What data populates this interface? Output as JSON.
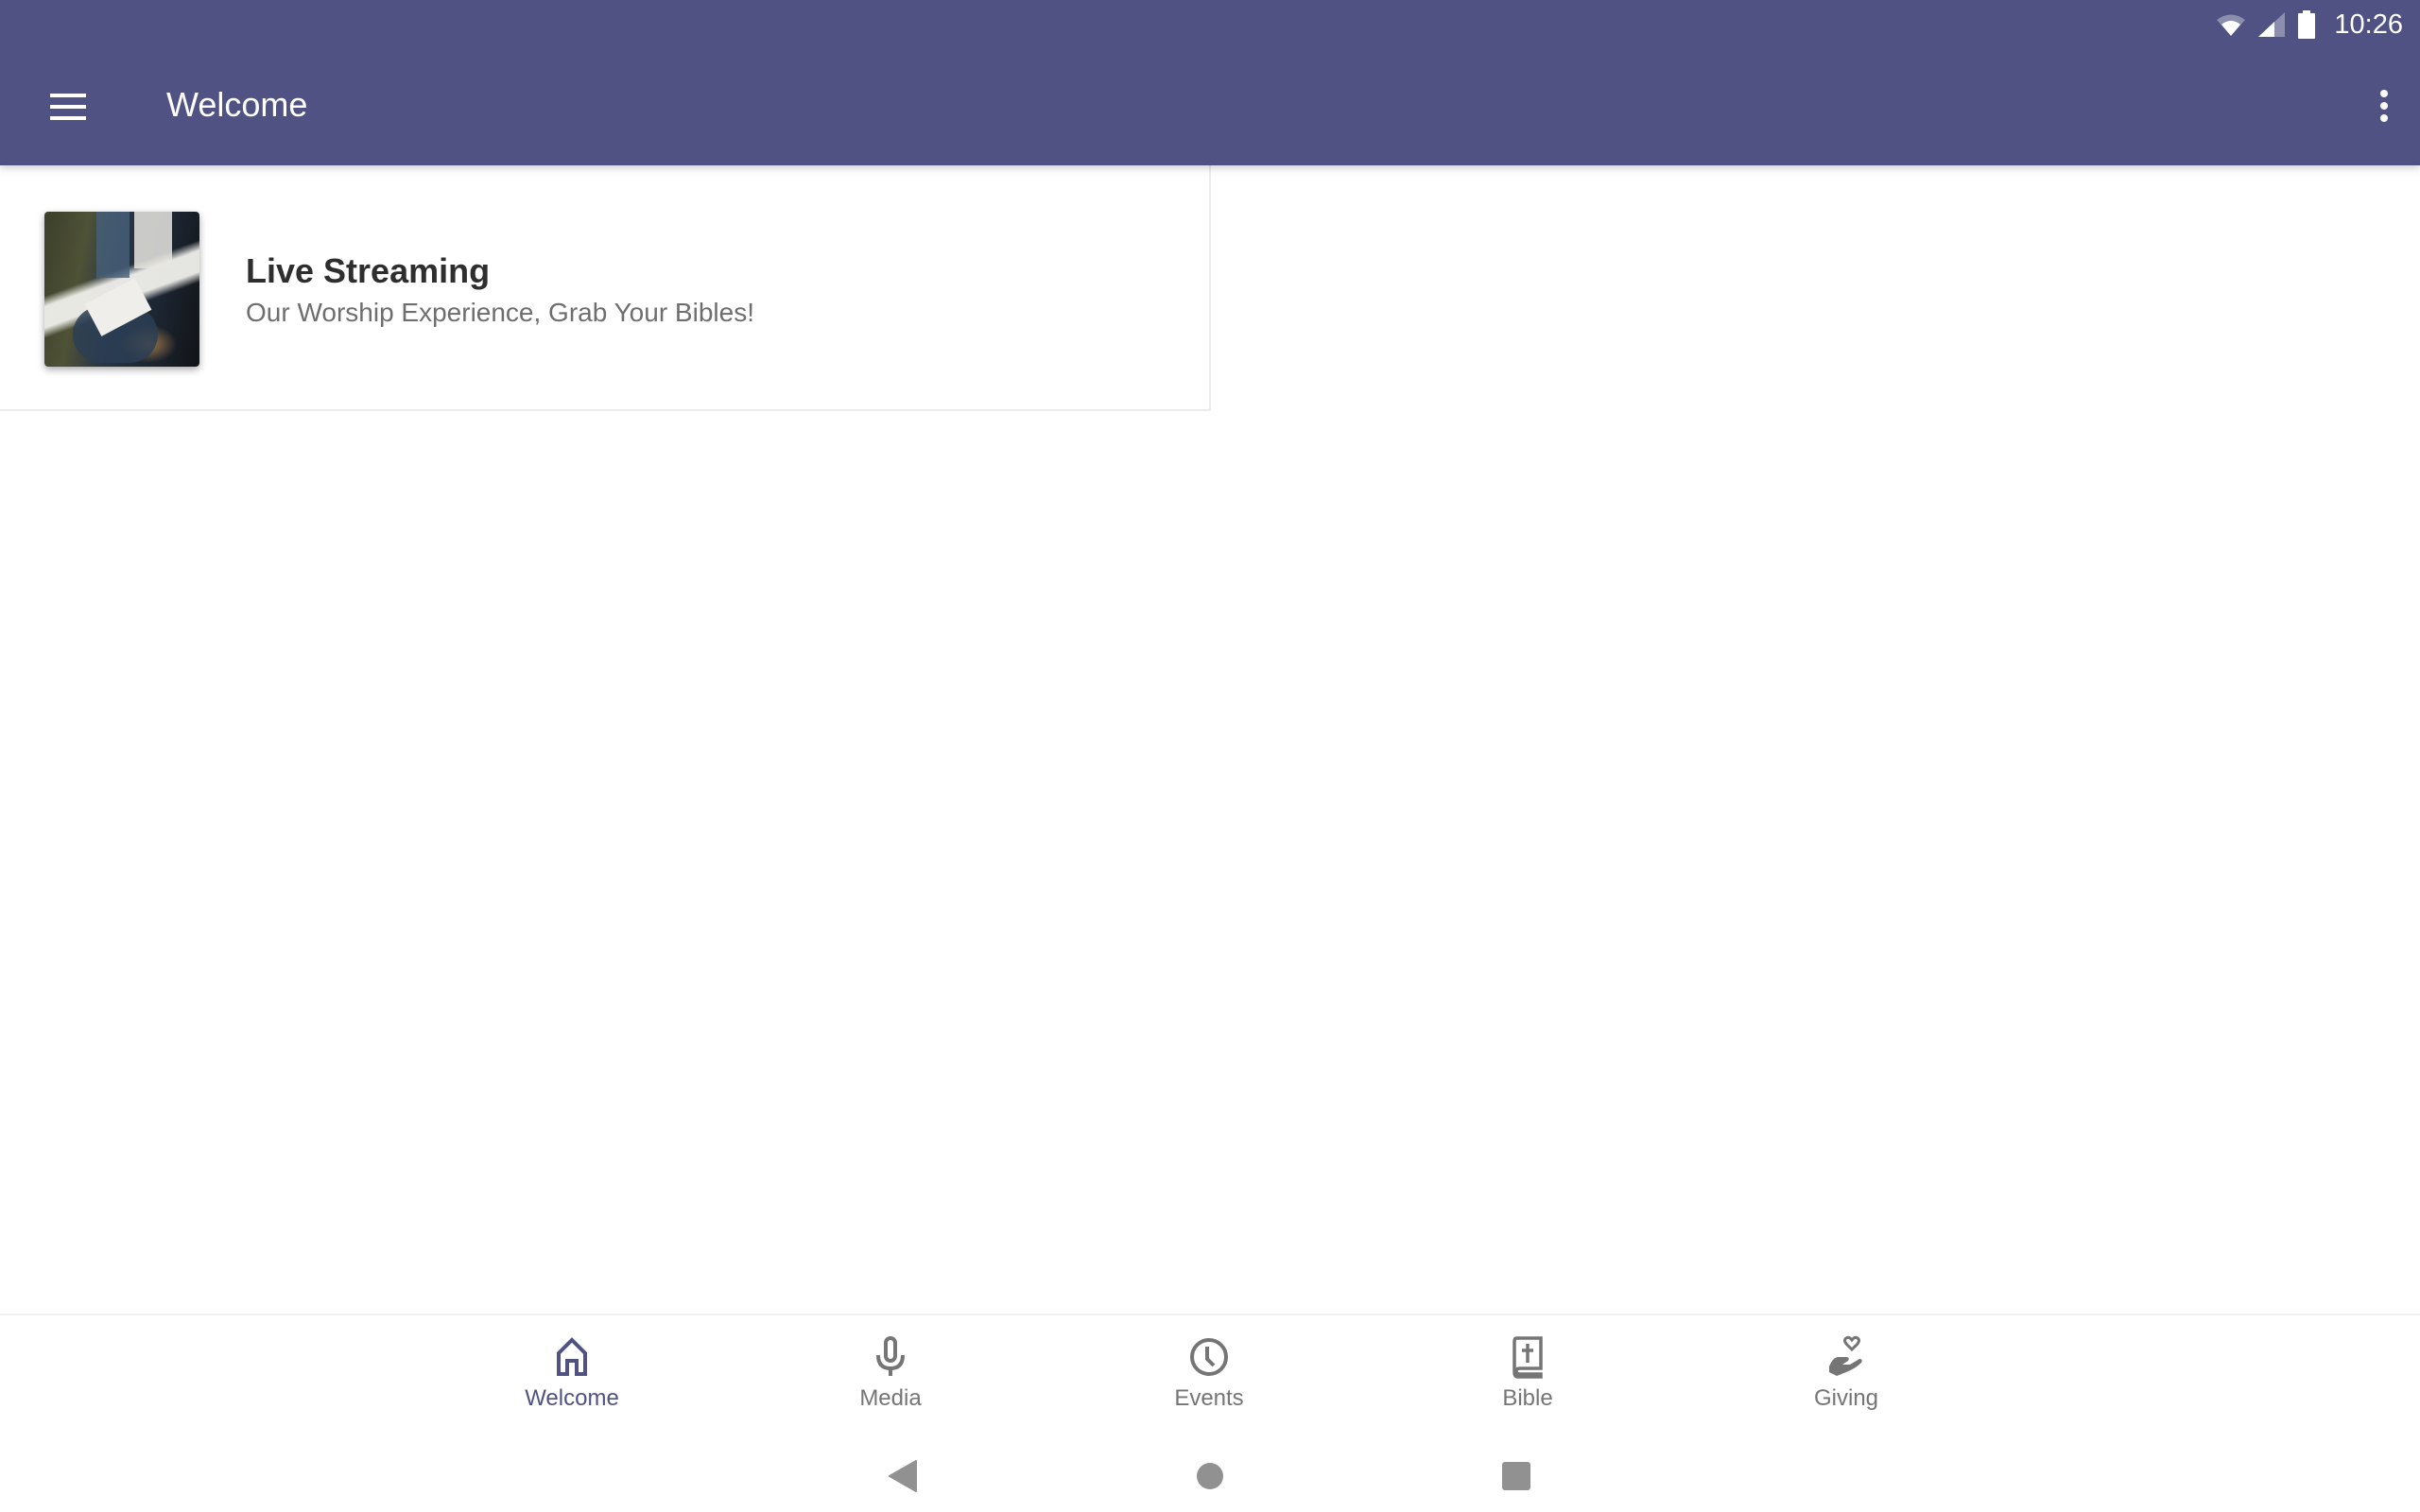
{
  "status_bar": {
    "time": "10:26",
    "icons": [
      "wifi-icon",
      "cell-signal-icon",
      "battery-icon"
    ]
  },
  "app_bar": {
    "title": "Welcome",
    "menu_icon": "hamburger-menu-icon",
    "overflow_icon": "more-vert-icon"
  },
  "content": {
    "items": [
      {
        "title": "Live Streaming",
        "subtitle": "Our Worship Experience, Grab Your Bibles!",
        "thumbnail": "congregation-with-bibles-photo"
      }
    ]
  },
  "bottom_nav": {
    "active_color": "#4f5283",
    "inactive_color": "#757575",
    "items": [
      {
        "label": "Welcome",
        "icon": "home-icon",
        "active": true
      },
      {
        "label": "Media",
        "icon": "microphone-icon",
        "active": false
      },
      {
        "label": "Events",
        "icon": "clock-icon",
        "active": false
      },
      {
        "label": "Bible",
        "icon": "bible-icon",
        "active": false
      },
      {
        "label": "Giving",
        "icon": "giving-hand-heart-icon",
        "active": false
      }
    ]
  },
  "system_nav": {
    "buttons": [
      "back-icon",
      "home-circle-icon",
      "recents-icon"
    ]
  },
  "colors": {
    "primary": "#4f5283",
    "background": "#ffffff"
  }
}
